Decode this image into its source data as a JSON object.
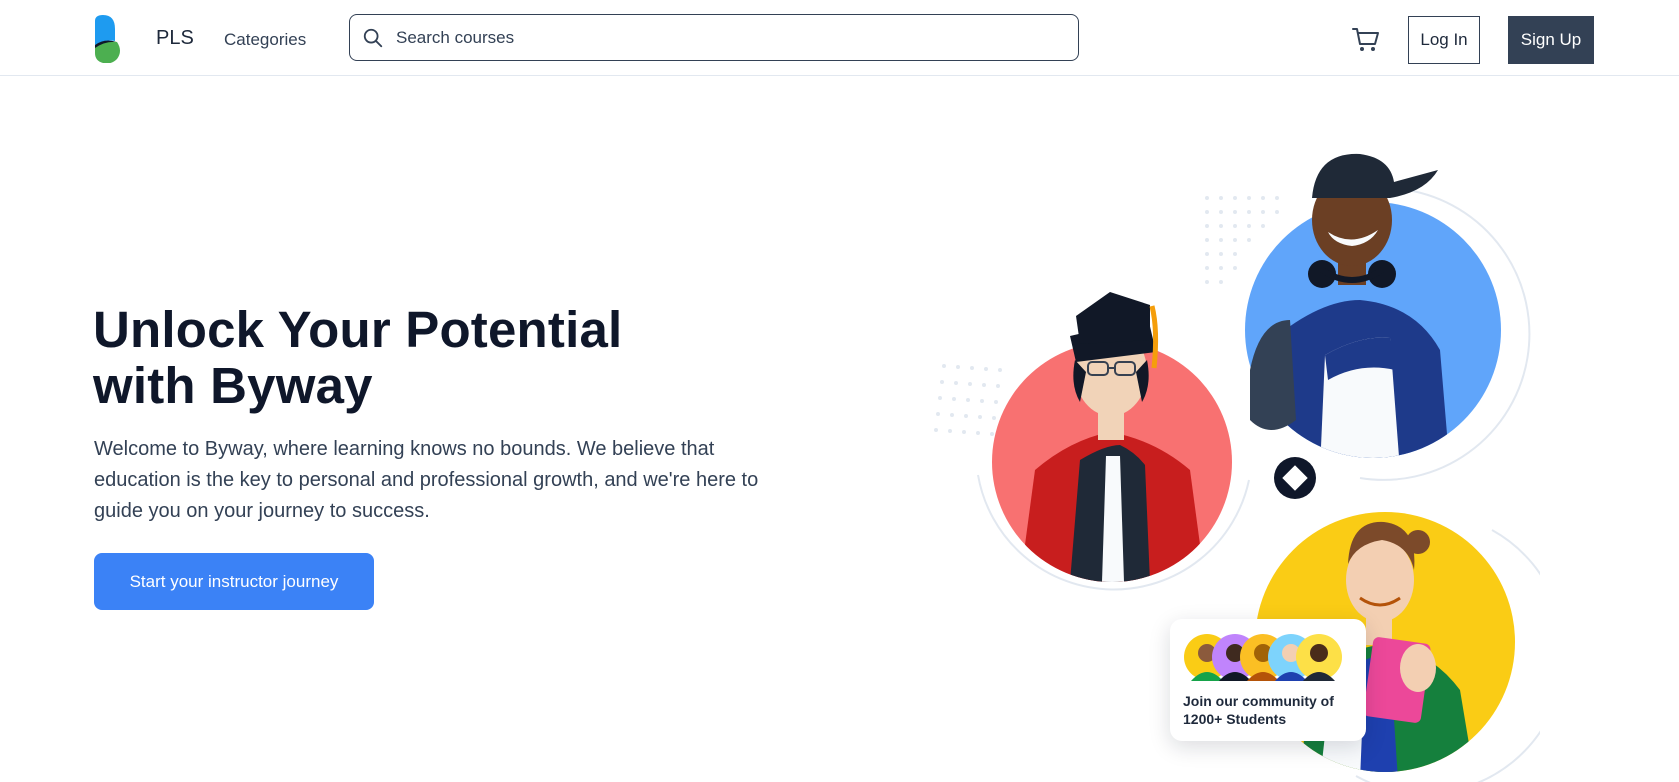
{
  "header": {
    "brand": "PLS",
    "categories_label": "Categories",
    "search_placeholder": "Search courses",
    "login_label": "Log In",
    "signup_label": "Sign Up",
    "icons": [
      "logo-icon",
      "search-icon",
      "cart-icon"
    ]
  },
  "hero": {
    "title_line1": "Unlock Your Potential",
    "title_line2": "with Byway",
    "description": "Welcome to Byway, where learning knows no bounds. We believe that education is the key to personal and professional growth, and we're here to guide you on your journey to success.",
    "cta_label": "Start your instructor journey"
  },
  "community": {
    "text_line1": "Join our community of",
    "text_line2": "1200+ Students"
  },
  "colors": {
    "accent": "#3b82f6",
    "dark": "#334155",
    "circle_red": "#f87171",
    "circle_blue": "#60a5fa",
    "circle_yellow": "#facc15"
  }
}
